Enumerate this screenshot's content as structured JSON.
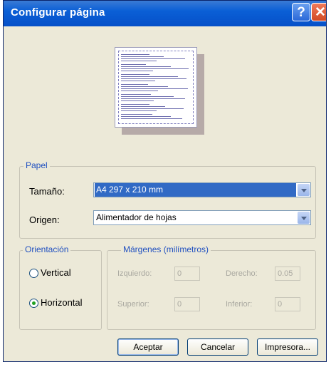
{
  "window": {
    "title": "Configurar página"
  },
  "titlebar": {
    "help_glyph": "?",
    "close_glyph": "✕"
  },
  "paper": {
    "legend": "Papel",
    "size_label": "Tamaño:",
    "size_value": "A4 297 x 210 mm",
    "source_label": "Origen:",
    "source_value": "Alimentador de hojas"
  },
  "orientation": {
    "legend": "Orientación",
    "vertical_label": "Vertical",
    "horizontal_label": "Horizontal",
    "selected": "Horizontal"
  },
  "margins": {
    "legend": "Márgenes (milímetros)",
    "left_label": "Izquierdo:",
    "left_value": "0",
    "right_label": "Derecho:",
    "right_value": "0.05",
    "top_label": "Superior:",
    "top_value": "0",
    "bottom_label": "Inferior:",
    "bottom_value": "0"
  },
  "buttons": {
    "accept": "Aceptar",
    "cancel": "Cancelar",
    "printer": "Impresora..."
  },
  "colors": {
    "title_bar": "#0a5fd6",
    "selection": "#316ac5",
    "dialog": "#ece9d8"
  }
}
